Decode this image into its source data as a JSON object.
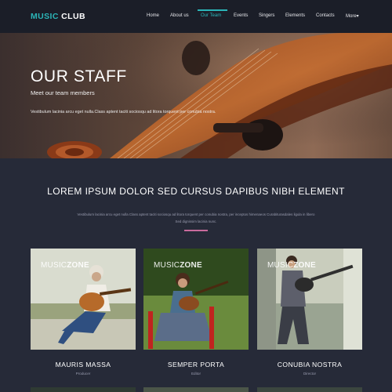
{
  "header": {
    "logo_accent": "MUSIC",
    "logo_rest": "CLUB",
    "nav": [
      {
        "label": "Home",
        "active": false
      },
      {
        "label": "About us",
        "active": false
      },
      {
        "label": "Our Team",
        "active": true
      },
      {
        "label": "Events",
        "active": false
      },
      {
        "label": "Singers",
        "active": false
      },
      {
        "label": "Elements",
        "active": false
      },
      {
        "label": "Contacts",
        "active": false
      },
      {
        "label": "More▾",
        "active": false
      }
    ]
  },
  "hero": {
    "title": "OUR STAFF",
    "subtitle": "Meet our team members",
    "text": "Vestibulum lacinia arcu eget nulla.Class aptent taciti sociosqu ad litora torquent per conubia nostra."
  },
  "section": {
    "title": "LOREM IPSUM DOLOR SED CURSUS DAPIBUS NIBH ELEMENT",
    "text": "Vestibulum lacinia arcu eget nulla Class aptent taciti sociosqu ad litora torquent per conubia nostra, per inceptos himenaeos Curabiturasdales ligula in libero Sed dignissim lacinia nunc."
  },
  "cards": [
    {
      "badge_light": "MUSIC",
      "badge_bold": "ZONE",
      "name": "MAURIS MASSA",
      "role": "Producer"
    },
    {
      "badge_light": "MUSIC",
      "badge_bold": "ZONE",
      "name": "SEMPER PORTA",
      "role": "Editor"
    },
    {
      "badge_light": "MUSIC",
      "badge_bold": "ZONE",
      "name": "CONUBIA NOSTRA",
      "role": "Director"
    }
  ],
  "colors": {
    "accent": "#2bb5b8",
    "background": "#262a38",
    "header": "#1b1e28",
    "divider": "#c96b9d"
  }
}
